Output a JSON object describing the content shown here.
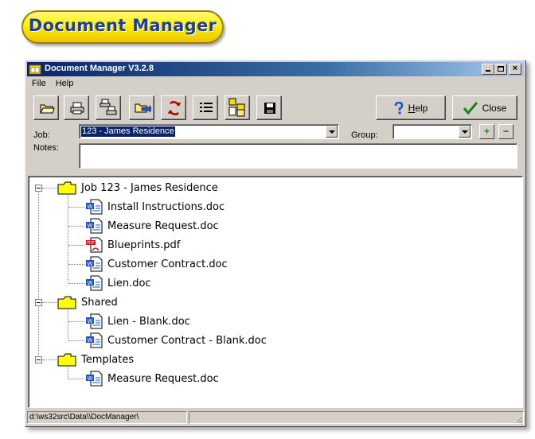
{
  "logo": {
    "text": "Document Manager"
  },
  "window": {
    "title": "Document Manager V3.2.8",
    "controls": {
      "close_glyph": "×"
    }
  },
  "menu": [
    "File",
    "Help"
  ],
  "toolbar": {
    "icons": [
      "open-folder-icon",
      "print-icon",
      "print-multiple-icon",
      "move-to-folder-icon",
      "refresh-icon",
      "list-view-icon",
      "files-tree-icon",
      "save-disk-icon"
    ],
    "help": {
      "accel": "H",
      "rest": "elp"
    },
    "close_label": "Close"
  },
  "job": {
    "label": "Job:",
    "value": "123 - James Residence"
  },
  "group": {
    "label": "Group:",
    "value": "",
    "add_glyph": "+",
    "remove_glyph": "−"
  },
  "notes": {
    "label": "Notes:",
    "value": ""
  },
  "tree": {
    "groups": [
      {
        "label": "Job 123 - James Residence",
        "items": [
          {
            "label": "Install Instructions.doc",
            "type": "doc"
          },
          {
            "label": "Measure Request.doc",
            "type": "doc"
          },
          {
            "label": "Blueprints.pdf",
            "type": "pdf"
          },
          {
            "label": "Customer Contract.doc",
            "type": "doc"
          },
          {
            "label": "Lien.doc",
            "type": "doc"
          }
        ]
      },
      {
        "label": "Shared",
        "items": [
          {
            "label": "Lien - Blank.doc",
            "type": "doc"
          },
          {
            "label": "Customer Contract - Blank.doc",
            "type": "doc"
          }
        ]
      },
      {
        "label": "Templates",
        "items": [
          {
            "label": "Measure Request.doc",
            "type": "doc"
          }
        ]
      }
    ]
  },
  "status": {
    "path": "d:\\ws32src\\Data\\\\DocManager\\",
    "pane2": ""
  },
  "colors": {
    "title_start": "#0a246a",
    "title_end": "#a6caf0",
    "face": "#d4d0c8",
    "logo_text": "#1a3fa0",
    "logo_fill": "#fff000"
  }
}
